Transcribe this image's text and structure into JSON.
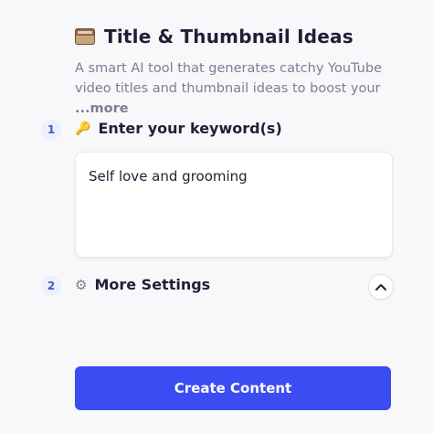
{
  "header": {
    "title": "Title & Thumbnail Ideas",
    "icon": "box-icon",
    "description": "A smart AI tool that generates catchy YouTube video titles and thumbnail ideas to boost your ",
    "more_link": "...more"
  },
  "steps": [
    {
      "number": "1",
      "label": "Enter your keyword(s)",
      "icon": "key-icon"
    },
    {
      "number": "2",
      "label": "More Settings",
      "icon": "gear-icon"
    }
  ],
  "keyword_input": {
    "value": "Self love and grooming"
  },
  "settings": {
    "collapse_icon": "chevron-up-icon"
  },
  "actions": {
    "create_label": "Create Content"
  },
  "colors": {
    "accent": "#3b4cf3",
    "step_bg": "#eceffd",
    "text_primary": "#1e2034",
    "text_secondary": "#7a7f93"
  }
}
